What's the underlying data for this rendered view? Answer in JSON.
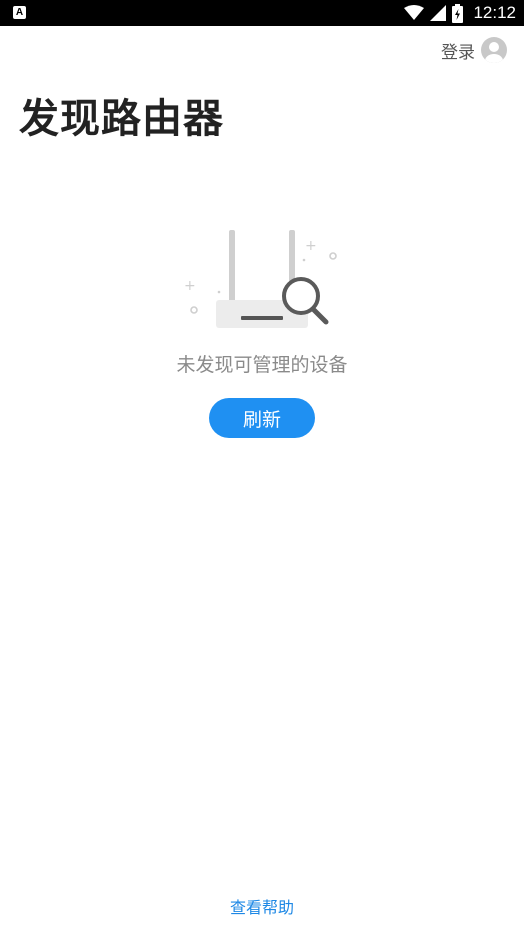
{
  "status_bar": {
    "left_icon": "A",
    "time": "12:12",
    "icons": [
      "wifi-icon",
      "signal-icon",
      "battery-charging-icon"
    ]
  },
  "header": {
    "login_label": "登录",
    "avatar_icon": "user-avatar-icon"
  },
  "page": {
    "title": "发现路由器"
  },
  "empty_state": {
    "illustration_icon": "router-search-icon",
    "message": "未发现可管理的设备"
  },
  "actions": {
    "refresh_label": "刷新"
  },
  "footer": {
    "help_label": "查看帮助"
  },
  "colors": {
    "accent": "#1f90f2",
    "link": "#1e88e5",
    "title": "#222222",
    "muted": "#8a8a8a"
  }
}
